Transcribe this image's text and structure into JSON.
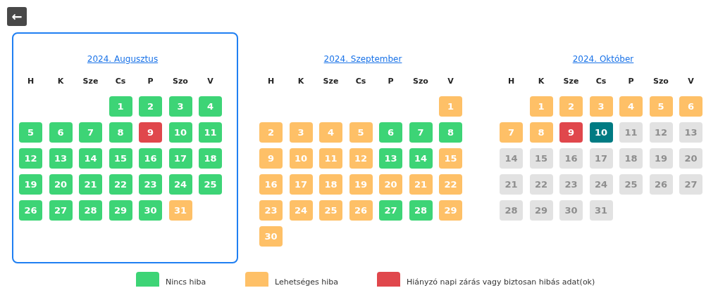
{
  "back_button": {
    "icon": "←"
  },
  "months": [
    {
      "title": "2024. Augusztus",
      "selected": true,
      "weekdays": [
        "H",
        "K",
        "Sze",
        "Cs",
        "P",
        "Szo",
        "V"
      ],
      "weeks": [
        [
          {
            "day": "1",
            "kind": "ok"
          },
          {
            "day": "2",
            "kind": "ok"
          },
          {
            "day": "3",
            "kind": "ok"
          },
          {
            "day": "4",
            "kind": "ok"
          }
        ],
        [
          {
            "day": "5",
            "kind": "ok"
          },
          {
            "day": "6",
            "kind": "ok"
          },
          {
            "day": "7",
            "kind": "ok"
          },
          {
            "day": "8",
            "kind": "ok"
          },
          {
            "day": "9",
            "kind": "error"
          },
          {
            "day": "10",
            "kind": "ok"
          },
          {
            "day": "11",
            "kind": "ok"
          }
        ],
        [
          {
            "day": "12",
            "kind": "ok"
          },
          {
            "day": "13",
            "kind": "ok"
          },
          {
            "day": "14",
            "kind": "ok"
          },
          {
            "day": "15",
            "kind": "ok"
          },
          {
            "day": "16",
            "kind": "ok"
          },
          {
            "day": "17",
            "kind": "ok"
          },
          {
            "day": "18",
            "kind": "ok"
          }
        ],
        [
          {
            "day": "19",
            "kind": "ok"
          },
          {
            "day": "20",
            "kind": "ok"
          },
          {
            "day": "21",
            "kind": "ok"
          },
          {
            "day": "22",
            "kind": "ok"
          },
          {
            "day": "23",
            "kind": "ok"
          },
          {
            "day": "24",
            "kind": "ok"
          },
          {
            "day": "25",
            "kind": "ok"
          }
        ],
        [
          {
            "day": "26",
            "kind": "ok"
          },
          {
            "day": "27",
            "kind": "ok"
          },
          {
            "day": "28",
            "kind": "ok"
          },
          {
            "day": "29",
            "kind": "ok"
          },
          {
            "day": "30",
            "kind": "ok"
          },
          {
            "day": "31",
            "kind": "warning"
          }
        ]
      ]
    },
    {
      "title": "2024. Szeptember",
      "selected": false,
      "weekdays": [
        "H",
        "K",
        "Sze",
        "Cs",
        "P",
        "Szo",
        "V"
      ],
      "weeks": [
        [
          {
            "day": "1",
            "kind": "warning"
          }
        ],
        [
          {
            "day": "2",
            "kind": "warning"
          },
          {
            "day": "3",
            "kind": "warning"
          },
          {
            "day": "4",
            "kind": "warning"
          },
          {
            "day": "5",
            "kind": "warning"
          },
          {
            "day": "6",
            "kind": "ok"
          },
          {
            "day": "7",
            "kind": "ok"
          },
          {
            "day": "8",
            "kind": "ok"
          }
        ],
        [
          {
            "day": "9",
            "kind": "warning"
          },
          {
            "day": "10",
            "kind": "warning"
          },
          {
            "day": "11",
            "kind": "warning"
          },
          {
            "day": "12",
            "kind": "warning"
          },
          {
            "day": "13",
            "kind": "ok"
          },
          {
            "day": "14",
            "kind": "ok"
          },
          {
            "day": "15",
            "kind": "warning"
          }
        ],
        [
          {
            "day": "16",
            "kind": "warning"
          },
          {
            "day": "17",
            "kind": "warning"
          },
          {
            "day": "18",
            "kind": "warning"
          },
          {
            "day": "19",
            "kind": "warning"
          },
          {
            "day": "20",
            "kind": "warning"
          },
          {
            "day": "21",
            "kind": "warning"
          },
          {
            "day": "22",
            "kind": "warning"
          }
        ],
        [
          {
            "day": "23",
            "kind": "warning"
          },
          {
            "day": "24",
            "kind": "warning"
          },
          {
            "day": "25",
            "kind": "warning"
          },
          {
            "day": "26",
            "kind": "warning"
          },
          {
            "day": "27",
            "kind": "ok"
          },
          {
            "day": "28",
            "kind": "ok"
          },
          {
            "day": "29",
            "kind": "warning"
          }
        ],
        [
          {
            "day": "30",
            "kind": "warning"
          }
        ]
      ]
    },
    {
      "title": "2024. Október",
      "selected": false,
      "weekdays": [
        "H",
        "K",
        "Sze",
        "Cs",
        "P",
        "Szo",
        "V"
      ],
      "weeks": [
        [
          {
            "day": "1",
            "kind": "warning"
          },
          {
            "day": "2",
            "kind": "warning"
          },
          {
            "day": "3",
            "kind": "warning"
          },
          {
            "day": "4",
            "kind": "warning"
          },
          {
            "day": "5",
            "kind": "warning"
          },
          {
            "day": "6",
            "kind": "warning"
          }
        ],
        [
          {
            "day": "7",
            "kind": "warning"
          },
          {
            "day": "8",
            "kind": "warning"
          },
          {
            "day": "9",
            "kind": "error"
          },
          {
            "day": "10",
            "kind": "today"
          },
          {
            "day": "11",
            "kind": "future"
          },
          {
            "day": "12",
            "kind": "future"
          },
          {
            "day": "13",
            "kind": "future"
          }
        ],
        [
          {
            "day": "14",
            "kind": "future"
          },
          {
            "day": "15",
            "kind": "future"
          },
          {
            "day": "16",
            "kind": "future"
          },
          {
            "day": "17",
            "kind": "future"
          },
          {
            "day": "18",
            "kind": "future"
          },
          {
            "day": "19",
            "kind": "future"
          },
          {
            "day": "20",
            "kind": "future"
          }
        ],
        [
          {
            "day": "21",
            "kind": "future"
          },
          {
            "day": "22",
            "kind": "future"
          },
          {
            "day": "23",
            "kind": "future"
          },
          {
            "day": "24",
            "kind": "future"
          },
          {
            "day": "25",
            "kind": "future"
          },
          {
            "day": "26",
            "kind": "future"
          },
          {
            "day": "27",
            "kind": "future"
          }
        ],
        [
          {
            "day": "28",
            "kind": "future"
          },
          {
            "day": "29",
            "kind": "future"
          },
          {
            "day": "30",
            "kind": "future"
          },
          {
            "day": "31",
            "kind": "future"
          }
        ]
      ]
    }
  ],
  "legend": [
    {
      "label": "Nincs hiba",
      "color": "#3dd476"
    },
    {
      "label": "Lehetséges hiba",
      "color": "#fec067"
    },
    {
      "label": "Hiányzó napi zárás vagy biztosan hibás adat(ok)",
      "color": "#e0474c"
    }
  ]
}
